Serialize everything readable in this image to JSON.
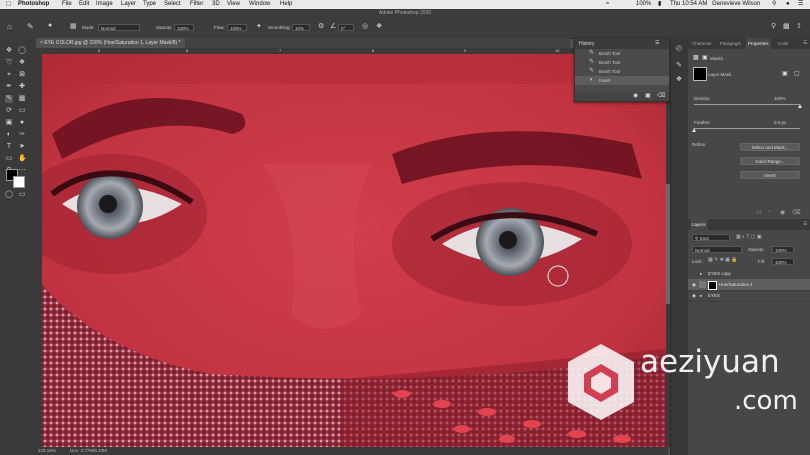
{
  "menubar": {
    "app": "Photoshop",
    "items": [
      "File",
      "Edit",
      "Image",
      "Layer",
      "Type",
      "Select",
      "Filter",
      "3D",
      "View",
      "Window",
      "Help"
    ],
    "battery": "100%",
    "clock": "Thu 10:54 AM",
    "user": "Genevieve Wilson"
  },
  "app_title": "Adobe Photoshop 2020",
  "options": {
    "mode_label": "Mode:",
    "mode_value": "Normal",
    "opacity_label": "Opacity:",
    "opacity_value": "100%",
    "flow_label": "Flow:",
    "flow_value": "100%",
    "smoothing_label": "Smoothing:",
    "smoothing_value": "10%",
    "angle_value": "0°"
  },
  "document_tab": "EYE COLOR.jpg @ 228% (Hue/Saturation 1, Layer Mask/8) *",
  "ruler_marks": [
    "5",
    "6",
    "7",
    "8",
    "9",
    "10",
    "11"
  ],
  "history": {
    "title": "History",
    "items": [
      {
        "label": "Brush Tool",
        "icon": "brush-icon"
      },
      {
        "label": "Brush Tool",
        "icon": "brush-icon"
      },
      {
        "label": "Brush Tool",
        "icon": "brush-icon"
      },
      {
        "label": "Invert",
        "icon": "invert-icon"
      }
    ]
  },
  "panels": {
    "tabs": [
      "Character",
      "Paragraph",
      "Properties",
      "Color"
    ],
    "active_tab": "Properties",
    "masks_label": "Masks",
    "layer_mask_label": "Layer Mask",
    "density_label": "Density:",
    "density_value": "100%",
    "density_fraction": 1.0,
    "feather_label": "Feather:",
    "feather_value": "0.0 px",
    "feather_fraction": 0.0,
    "refine_label": "Refine:",
    "select_mask": "Select and Mask...",
    "color_range": "Color Range...",
    "invert": "Invert"
  },
  "layers": {
    "tab": "Layers",
    "kind_label": "Kind",
    "blend_mode": "Normal",
    "opacity_label": "Opacity:",
    "opacity_value": "100%",
    "lock_label": "Lock:",
    "fill_label": "Fill:",
    "fill_value": "100%",
    "items": [
      {
        "name": "EYES copy",
        "selected": false
      },
      {
        "name": "Hue/Saturation 1",
        "selected": true
      },
      {
        "name": "EYES",
        "selected": false
      }
    ]
  },
  "status": {
    "zoom": "228.19%",
    "doc": "Doc: 3.77M/9.33M"
  },
  "watermark": {
    "brand": "aeziyuan",
    "domain": ".com"
  },
  "colors": {
    "mask_overlay": "#c43240",
    "panel_bg": "#474747",
    "toolbar_bg": "#3a3a3a"
  }
}
